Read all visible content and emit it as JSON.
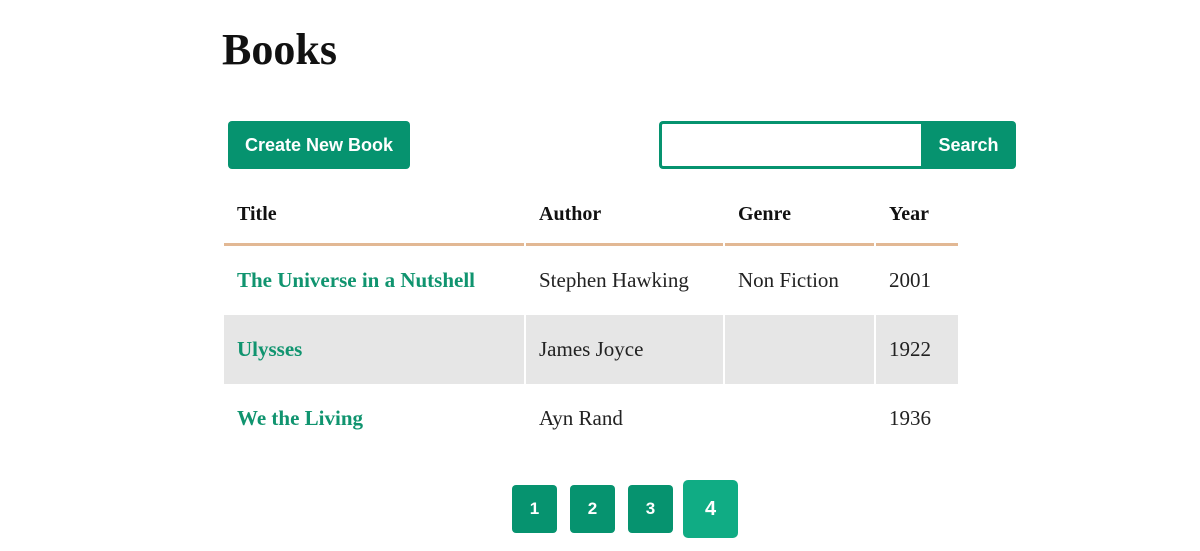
{
  "page": {
    "title": "Books"
  },
  "toolbar": {
    "create_label": "Create New Book",
    "search_placeholder": "",
    "search_value": "",
    "search_label": "Search"
  },
  "table": {
    "headers": {
      "title": "Title",
      "author": "Author",
      "genre": "Genre",
      "year": "Year"
    },
    "rows": [
      {
        "title": "The Universe in a Nutshell",
        "author": "Stephen Hawking",
        "genre": "Non Fiction",
        "year": "2001"
      },
      {
        "title": "Ulysses",
        "author": "James Joyce",
        "genre": "",
        "year": "1922"
      },
      {
        "title": "We the Living",
        "author": "Ayn Rand",
        "genre": "",
        "year": "1936"
      }
    ]
  },
  "pagination": {
    "pages": [
      "1",
      "2",
      "3",
      "4"
    ],
    "current": "4"
  },
  "colors": {
    "accent": "#06936f",
    "active_page": "#10ac84",
    "header_border": "#e2b894",
    "alt_row": "#e6e6e6"
  }
}
